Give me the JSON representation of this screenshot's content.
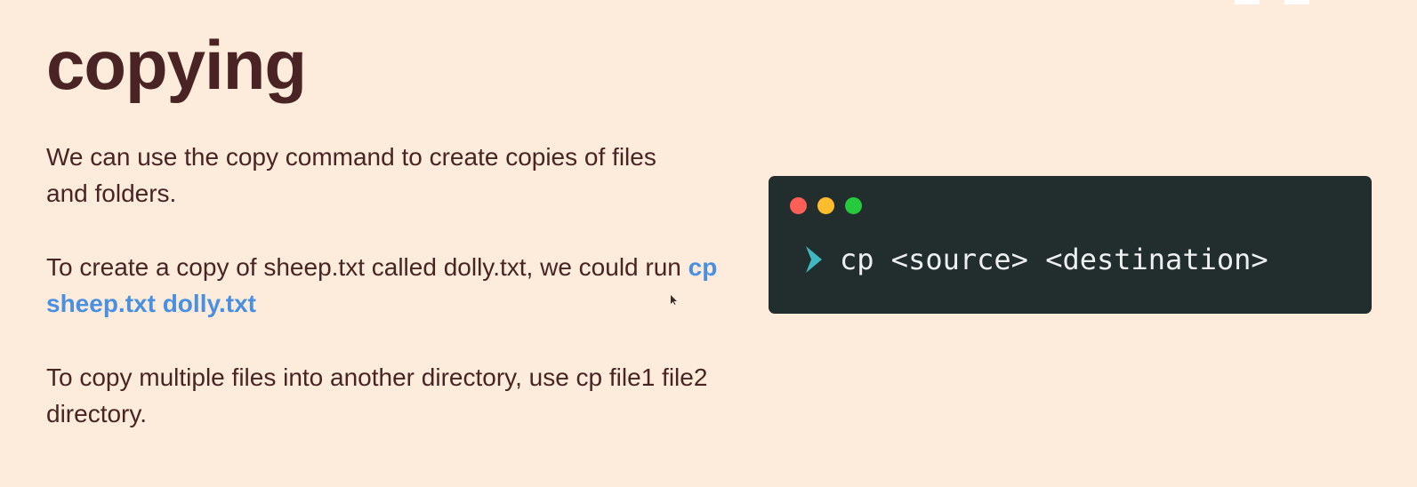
{
  "slide": {
    "title": "copying",
    "paragraph1": "We can use the copy command to create copies of files and folders.",
    "paragraph2": {
      "text": "To create a copy of sheep.txt called dolly.txt, we could run ",
      "code": "cp sheep.txt dolly.txt"
    },
    "paragraph3": "To copy multiple files into another directory, use cp file1 file2 directory."
  },
  "terminal": {
    "command": "cp <source> <destination>",
    "prompt_icon": "chevron-right-icon",
    "prompt_color": "#3fb8c0",
    "dot_colors": [
      "#ff5f56",
      "#ffbd2e",
      "#27c93f"
    ],
    "background": "#222d2e"
  },
  "colors": {
    "background": "#fdecdb",
    "text": "#4a2424",
    "code_highlight": "#4a90e2"
  }
}
